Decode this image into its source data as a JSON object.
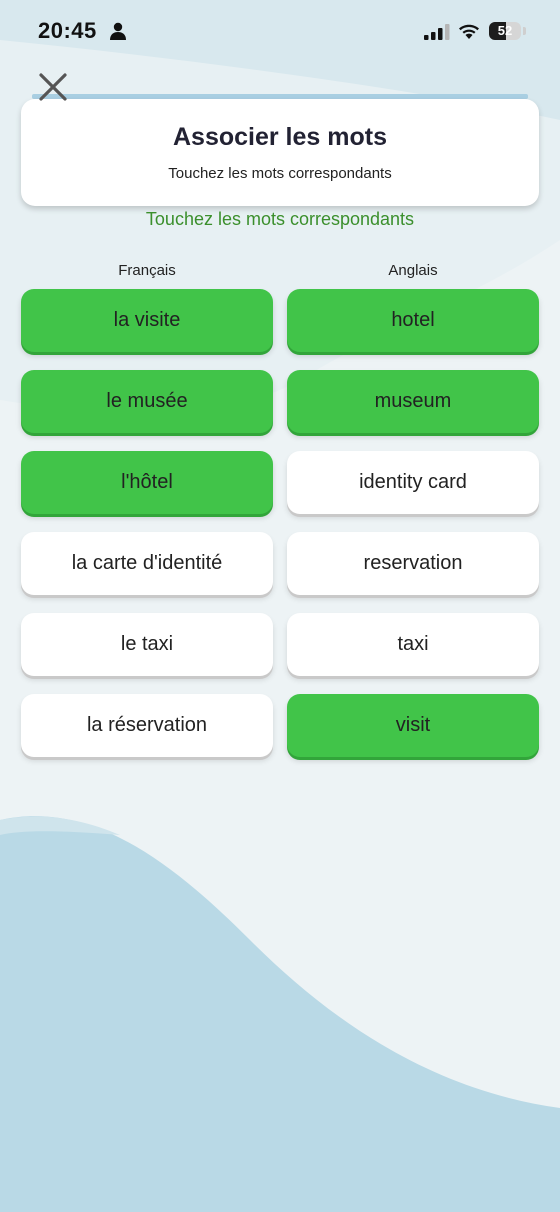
{
  "status": {
    "time": "20:45",
    "battery_percent": 52,
    "battery_label": "52"
  },
  "icons": {
    "close": "close-icon",
    "person": "person-icon",
    "signal": "cellular-signal-icon",
    "wifi": "wifi-icon",
    "battery": "battery-icon"
  },
  "header": {
    "title": "Associer les mots",
    "subtitle": "Touchez les mots correspondants"
  },
  "instruction": "Touchez les mots correspondants",
  "columns": {
    "left_heading": "Français",
    "right_heading": "Anglais"
  },
  "left_words": [
    {
      "label": "la visite",
      "state": "matched"
    },
    {
      "label": "le musée",
      "state": "matched"
    },
    {
      "label": "l'hôtel",
      "state": "matched"
    },
    {
      "label": "la carte d'identité",
      "state": "unmatched"
    },
    {
      "label": "le taxi",
      "state": "unmatched"
    },
    {
      "label": "la réservation",
      "state": "unmatched"
    }
  ],
  "right_words": [
    {
      "label": "hotel",
      "state": "matched"
    },
    {
      "label": "museum",
      "state": "matched"
    },
    {
      "label": "identity card",
      "state": "unmatched"
    },
    {
      "label": "reservation",
      "state": "unmatched"
    },
    {
      "label": "taxi",
      "state": "unmatched"
    },
    {
      "label": "visit",
      "state": "matched"
    }
  ],
  "colors": {
    "matched": "#41c449",
    "unmatched": "#ffffff",
    "instruction": "#3b8f2c",
    "background_wave": "#b9d9e6"
  }
}
